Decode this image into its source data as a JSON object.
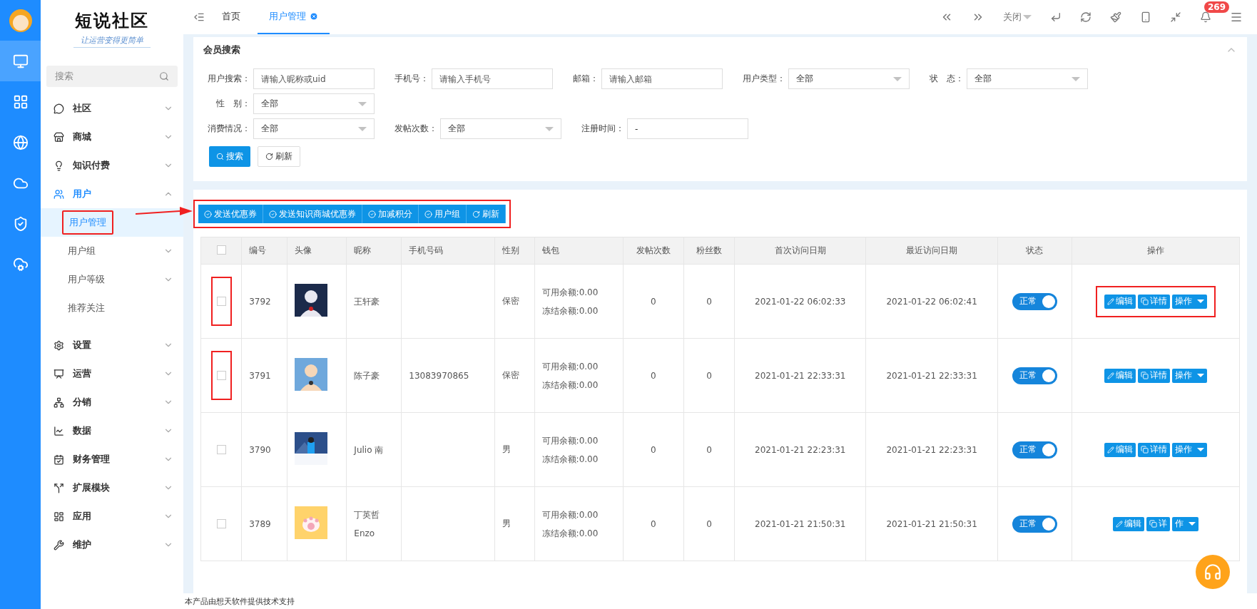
{
  "logo": {
    "title": "短说社区",
    "slogan": "让运营变得更简单"
  },
  "rail": [
    {
      "selected": true
    },
    {
      "selected": false
    },
    {
      "selected": false
    },
    {
      "selected": false
    },
    {
      "selected": false
    },
    {
      "selected": false
    }
  ],
  "sidebar": {
    "search": {
      "placeholder": "搜索"
    },
    "items": [
      {
        "label": "社区",
        "expanded": false
      },
      {
        "label": "商城",
        "expanded": false
      },
      {
        "label": "知识付费",
        "expanded": false
      },
      {
        "label": "用户",
        "expanded": true,
        "children": [
          {
            "label": "用户管理",
            "selected": true,
            "highlighted": true,
            "has_arrow": false
          },
          {
            "label": "用户组",
            "selected": false,
            "highlighted": false,
            "has_arrow": true
          },
          {
            "label": "用户等级",
            "selected": false,
            "highlighted": false,
            "has_arrow": true
          },
          {
            "label": "推荐关注",
            "selected": false,
            "highlighted": false,
            "has_arrow": false
          }
        ]
      },
      {
        "label": "设置",
        "expanded": false
      },
      {
        "label": "运营",
        "expanded": false
      },
      {
        "label": "分销",
        "expanded": false
      },
      {
        "label": "数据",
        "expanded": false
      },
      {
        "label": "财务管理",
        "expanded": false
      },
      {
        "label": "扩展模块",
        "expanded": false
      },
      {
        "label": "应用",
        "expanded": false
      },
      {
        "label": "维护",
        "expanded": false
      }
    ]
  },
  "tabs": [
    {
      "label": "首页",
      "selected": false,
      "closable": false
    },
    {
      "label": "用户管理",
      "selected": true,
      "closable": true
    }
  ],
  "topbar": {
    "close_label": "关闭",
    "notifications": "269"
  },
  "search_panel": {
    "title": "会员搜索",
    "fields": [
      {
        "kind": "input",
        "label": "用户搜索：",
        "placeholder": "请输入昵称或uid"
      },
      {
        "kind": "input",
        "label": "手机号：",
        "placeholder": "请输入手机号"
      },
      {
        "kind": "input",
        "label": "邮箱：",
        "placeholder": "请输入邮箱"
      },
      {
        "kind": "select",
        "label": "用户类型：",
        "value": "全部"
      },
      {
        "kind": "select",
        "label": "状　态：",
        "value": "全部"
      },
      {
        "kind": "select",
        "label": "性　别：",
        "value": "全部"
      },
      {
        "kind": "select",
        "label": "消费情况：",
        "value": "全部"
      },
      {
        "kind": "select",
        "label": "发帖次数：",
        "value": "全部"
      },
      {
        "kind": "input",
        "label": "注册时间：",
        "value": "-"
      }
    ],
    "search_button": "搜索",
    "refresh_button": "刷新"
  },
  "batch_toolbar": {
    "highlighted": true,
    "buttons": [
      "发送优惠券",
      "发送知识商城优惠券",
      "加减积分",
      "用户组",
      "刷新"
    ]
  },
  "table": {
    "header_checked": false,
    "columns": [
      "编号",
      "头像",
      "昵称",
      "手机号码",
      "性别",
      "钱包",
      "发帖次数",
      "粉丝数",
      "首次访问日期",
      "最近访问日期",
      "状态",
      "操作"
    ],
    "rows": [
      {
        "checked": false,
        "checkbox_highlighted": true,
        "id": "3792",
        "nickname": [
          "王轩豪"
        ],
        "gender": "保密",
        "wallet": [
          "可用余额:0.00",
          "冻结余额:0.00"
        ],
        "posts": "0",
        "fans": "0",
        "first_visit": "2021-01-22 06:02:33",
        "last_visit": "2021-01-22 06:02:41",
        "status": {
          "label": "正常",
          "on": true
        },
        "actions": [
          "编辑",
          "详情",
          "操作"
        ],
        "actions_highlighted": true
      },
      {
        "checked": false,
        "checkbox_highlighted": true,
        "id": "3791",
        "nickname": [
          "陈子豪"
        ],
        "phone": "13083970865",
        "gender": "保密",
        "wallet": [
          "可用余额:0.00",
          "冻结余额:0.00"
        ],
        "posts": "0",
        "fans": "0",
        "first_visit": "2021-01-21 22:33:31",
        "last_visit": "2021-01-21 22:33:31",
        "status": {
          "label": "正常",
          "on": true
        },
        "actions": [
          "编辑",
          "详情",
          "操作"
        ],
        "actions_highlighted": false
      },
      {
        "checked": false,
        "checkbox_highlighted": false,
        "id": "3790",
        "nickname": [
          "Julio 南"
        ],
        "gender": "男",
        "wallet": [
          "可用余额:0.00",
          "冻结余额:0.00"
        ],
        "posts": "0",
        "fans": "0",
        "first_visit": "2021-01-21 22:23:31",
        "last_visit": "2021-01-21 22:23:31",
        "status": {
          "label": "正常",
          "on": true
        },
        "actions": [
          "编辑",
          "详情",
          "操作"
        ],
        "actions_highlighted": false
      },
      {
        "checked": false,
        "checkbox_highlighted": false,
        "id": "3789",
        "nickname": [
          "丁英哲",
          "Enzo"
        ],
        "gender": "男",
        "wallet": [
          "可用余额:0.00",
          "冻结余额:0.00"
        ],
        "posts": "0",
        "fans": "0",
        "first_visit": "2021-01-21 21:50:31",
        "last_visit": "2021-01-21 21:50:31",
        "status": {
          "label": "正常",
          "on": true
        },
        "actions": [
          "编辑",
          "详",
          "作"
        ],
        "actions_highlighted": false
      }
    ]
  },
  "footer": "本产品由想天软件提供技术支持"
}
